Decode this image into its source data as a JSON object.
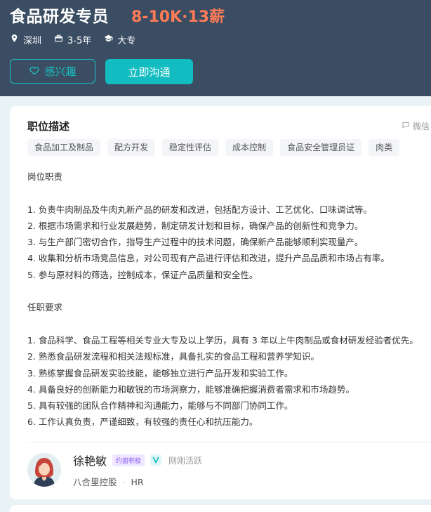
{
  "header": {
    "job_title": "食品研发专员",
    "salary": "8-10K·13薪",
    "meta": [
      {
        "icon": "location-icon",
        "text": "深圳"
      },
      {
        "icon": "briefcase-icon",
        "text": "3-5年"
      },
      {
        "icon": "graduation-cap-icon",
        "text": "大专"
      }
    ],
    "interest_label": "感兴趣",
    "chat_label": "立即沟通"
  },
  "card": {
    "section_title": "职位描述",
    "wechat_label": "微信",
    "tags": [
      "食品加工及制品",
      "配方开发",
      "稳定性评估",
      "成本控制",
      "食品安全管理员证",
      "肉类"
    ],
    "description": [
      "岗位职责",
      "",
      "1. 负责牛肉制品及牛肉丸新产品的研发和改进，包括配方设计、工艺优化、口味调试等。",
      "2. 根据市场需求和行业发展趋势，制定研发计划和目标，确保产品的创新性和竞争力。",
      "3. 与生产部门密切合作，指导生产过程中的技术问题，确保新产品能够顺利实现量产。",
      "4. 收集和分析市场竞品信息，对公司现有产品进行评估和改进，提升产品品质和市场占有率。",
      "5. 参与原材料的筛选，控制成本，保证产品质量和安全性。",
      "",
      "任职要求",
      "",
      "1. 食品科学、食品工程等相关专业大专及以上学历，具有 3 年以上牛肉制品或食材研发经验者优先。",
      "2. 熟悉食品研发流程和相关法规标准，具备扎实的食品工程和营养学知识。",
      "3. 熟练掌握食品研发实验技能，能够独立进行产品开发和实验工作。",
      "4. 具备良好的创新能力和敏锐的市场洞察力，能够准确把握消费者需求和市场趋势。",
      "5. 具有较强的团队合作精神和沟通能力，能够与不同部门协同工作。",
      "6. 工作认真负责，严谨细致，有较强的责任心和抗压能力。"
    ]
  },
  "hr": {
    "name": "徐艳敏",
    "badge": "约面积极",
    "status": "刚刚活跃",
    "company": "八合里控股",
    "role": "HR"
  },
  "colors": {
    "header_bg": "#3a4d63",
    "salary": "#ff7b57",
    "accent": "#12bcc0",
    "badge": "#8b5cf6"
  }
}
